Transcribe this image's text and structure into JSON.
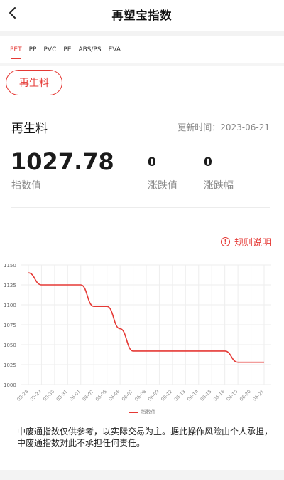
{
  "header": {
    "title": "再塑宝指数"
  },
  "tabs": [
    {
      "label": "PET"
    },
    {
      "label": "PP"
    },
    {
      "label": "PVC"
    },
    {
      "label": "PE"
    },
    {
      "label": "ABS/PS"
    },
    {
      "label": "EVA"
    }
  ],
  "selected_filter": "再生料",
  "section": {
    "title": "再生料",
    "update_time": "更新时间：2023-06-21",
    "index_value": "1027.78",
    "index_label": "指数值",
    "change_value": "0",
    "change_label": "涨跌值",
    "change_pct": "0",
    "change_pct_label": "涨跌幅"
  },
  "rules_link": "规则说明",
  "colors": {
    "accent": "#e53935",
    "grid": "#eeeeee",
    "muted": "#888888"
  },
  "chart_data": {
    "type": "line",
    "categories": [
      "05-26",
      "05-29",
      "05-30",
      "05-31",
      "06-01",
      "06-02",
      "06-05",
      "06-06",
      "06-07",
      "06-08",
      "06-09",
      "06-12",
      "06-13",
      "06-14",
      "06-15",
      "06-16",
      "06-19",
      "06-20",
      "06-21"
    ],
    "series": [
      {
        "name": "指数值",
        "values": [
          1140,
          1125,
          1125,
          1125,
          1125,
          1098,
          1098,
          1070,
          1042,
          1042,
          1042,
          1042,
          1042,
          1042,
          1042,
          1042,
          1028,
          1028,
          1028
        ]
      }
    ],
    "ylim": [
      1000,
      1150
    ],
    "yticks": [
      "1000",
      "1025",
      "1050",
      "1075",
      "1100",
      "1125",
      "1150"
    ],
    "legend": "bottom-center",
    "grid": true
  },
  "disclaimer": "中废通指数仅供参考，以实际交易为主。据此操作风险由个人承担，中废通指数对此不承担任何责任。"
}
